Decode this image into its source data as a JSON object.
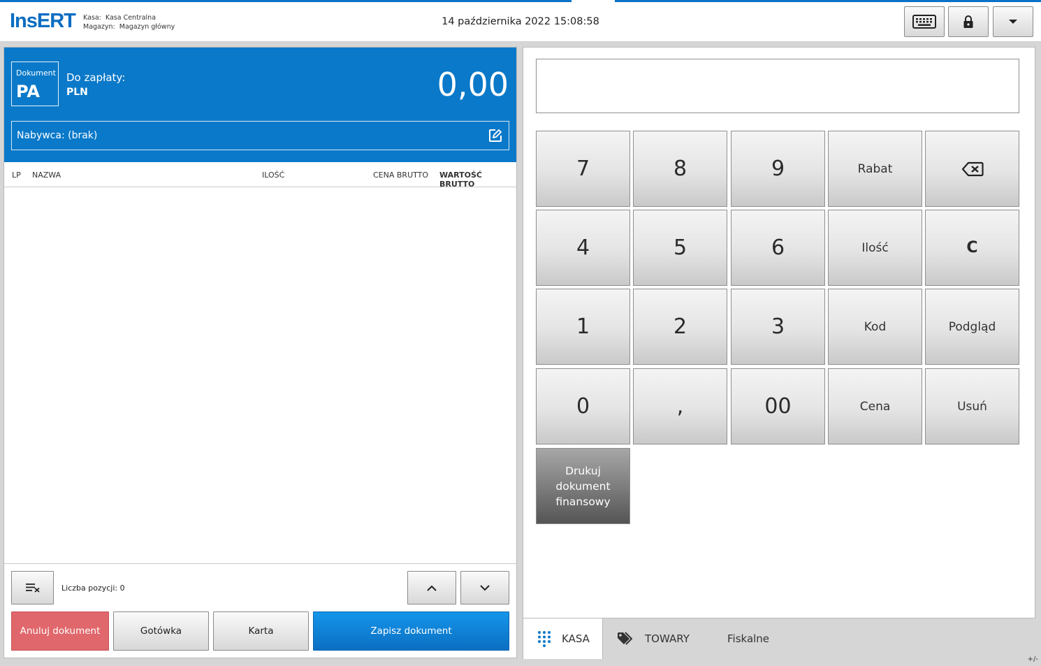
{
  "header": {
    "logo": "InsERT",
    "kasa_label": "Kasa:",
    "kasa_value": "Kasa Centralna",
    "magazyn_label": "Magazyn:",
    "magazyn_value": "Magazyn główny",
    "datetime": "14 października 2022 15:08:58",
    "buttons": [
      "keyboard-icon",
      "lock-icon",
      "dropdown-icon"
    ]
  },
  "document": {
    "label": "Dokument",
    "type": "PA",
    "to_pay_label": "Do zapłaty:",
    "currency": "PLN",
    "amount": "0,00",
    "buyer": "Nabywca: (brak)"
  },
  "table": {
    "columns": [
      "LP",
      "NAZWA",
      "ILOŚĆ",
      "CENA BRUTTO",
      "WARTOŚĆ BRUTTO"
    ],
    "rows": []
  },
  "footer": {
    "positions": "Liczba pozycji: 0",
    "cancel": "Anuluj dokument",
    "cash": "Gotówka",
    "card": "Karta",
    "save": "Zapisz dokument"
  },
  "keypad": {
    "row1": [
      "7",
      "8",
      "9",
      "Rabat"
    ],
    "row2": [
      "4",
      "5",
      "6",
      "Ilość",
      "C"
    ],
    "row3": [
      "1",
      "2",
      "3",
      "Kod",
      "Podgląd"
    ],
    "row4": [
      "0",
      ",",
      "00",
      "Cena",
      "Usuń"
    ],
    "print_line1": "Drukuj dokument",
    "print_line2": "finansowy"
  },
  "tabs": {
    "kasa": "KASA",
    "towary": "TOWARY",
    "fiskalne": "Fiskalne",
    "plusminus": "+/-"
  },
  "colors": {
    "accent": "#0a79c9",
    "cancel": "#e0676b",
    "save": "#0a80d8"
  }
}
